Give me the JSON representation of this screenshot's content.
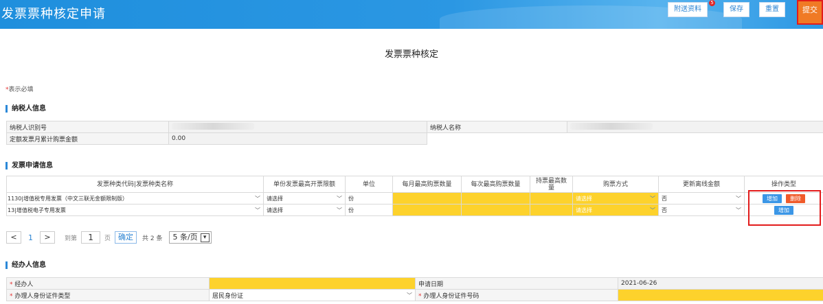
{
  "header": {
    "title": "发票票种核定申请",
    "buttons": {
      "attach": "附送资料",
      "badge": "5",
      "save": "保存",
      "reset": "重置",
      "submit": "提交"
    }
  },
  "doc_title": "发票票种核定",
  "required_note": {
    "star": "*",
    "text": "表示必填"
  },
  "taxpayer": {
    "section": "纳税人信息",
    "id_label": "纳税人识别号",
    "name_label": "纳税人名称",
    "quota_label": "定额发票月累计购票金额",
    "quota_value": "0.00"
  },
  "apply": {
    "section": "发票申请信息",
    "headers": [
      "发票种类代码|发票种类名称",
      "单份发票最高开票限额",
      "单位",
      "每月最高购票数量",
      "每次最高购票数量",
      "持票最高数量",
      "购票方式",
      "更新离线金额",
      "操作类型"
    ],
    "rows": [
      {
        "type": "1130|增值税专用发票（中文三联无金额限制版）",
        "limit": "请选择",
        "unit": "份",
        "buy_method": "请选择",
        "offline": "否",
        "add": "增加",
        "del": "删除"
      },
      {
        "type": "13|增值税电子专用发票",
        "limit": "请选择",
        "unit": "份",
        "buy_method": "请选择",
        "offline": "否",
        "add": "增加"
      }
    ]
  },
  "pager": {
    "prev": "<",
    "page": "1",
    "next": ">",
    "goto": "到第",
    "input": "1",
    "page_unit": "页",
    "confirm": "确定",
    "total": "共 2 条",
    "page_size": "5 条/页"
  },
  "agent": {
    "section": "经办人信息",
    "agent_label": "经办人",
    "date_label": "申请日期",
    "date_value": "2021-06-26",
    "id_type_label": "办理人身份证件类型",
    "id_type_value": "居民身份证",
    "id_no_label": "办理人身份证件号码"
  },
  "icons": {
    "caret": "▾",
    "select_arrow": "﹀"
  }
}
